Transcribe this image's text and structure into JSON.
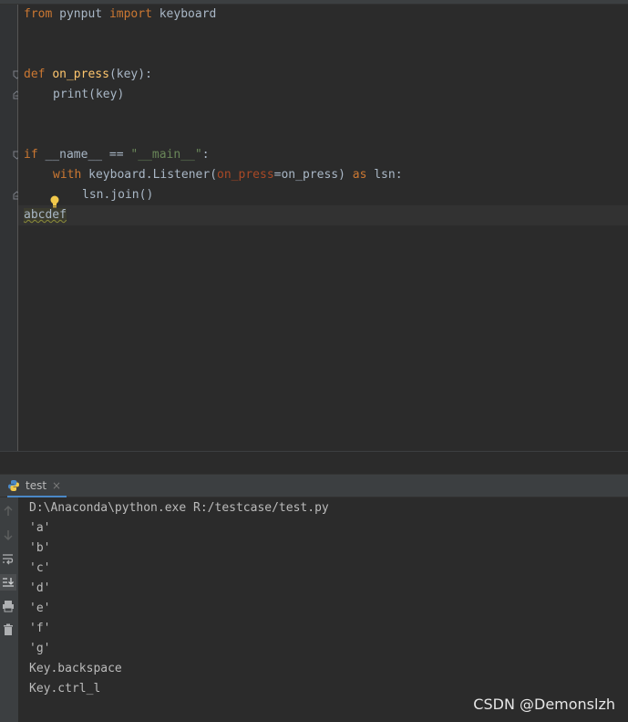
{
  "editor": {
    "lines": {
      "l1": {
        "from": "from",
        "mod": " pynput ",
        "imp": "import",
        "name": " keyboard"
      },
      "l4": {
        "def": "def",
        "fn": "on_press",
        "rest": "(key):"
      },
      "l5": {
        "text": "print(key)"
      },
      "l8": {
        "if": "if",
        "mid": " __name__ == ",
        "str": "\"__main__\"",
        "end": ":"
      },
      "l9": {
        "with": "with",
        "a": " keyboard.Listener(",
        "param": "on_press",
        "b": "=on_press) ",
        "as": "as",
        "c": " lsn:"
      },
      "l10": {
        "text": "lsn.join()"
      },
      "l11": {
        "text": "abcdef"
      }
    }
  },
  "run_panel": {
    "tab_label": "test",
    "tab_close": "×",
    "tools": [
      "up-arrow-icon",
      "down-arrow-icon",
      "soft-wrap-icon",
      "scroll-to-end-icon",
      "print-icon",
      "trash-icon"
    ],
    "output": [
      "D:\\Anaconda\\python.exe R:/testcase/test.py",
      "'a'",
      "'b'",
      "'c'",
      "'d'",
      "'e'",
      "'f'",
      "'g'",
      "Key.backspace",
      "Key.ctrl_l"
    ]
  },
  "watermark": "CSDN @Demonslzh",
  "colors": {
    "keyword": "#cc7832",
    "function": "#ffc66d",
    "string": "#6a8759",
    "param": "#aa4926",
    "text": "#a9b7c6",
    "background": "#2b2b2b"
  }
}
